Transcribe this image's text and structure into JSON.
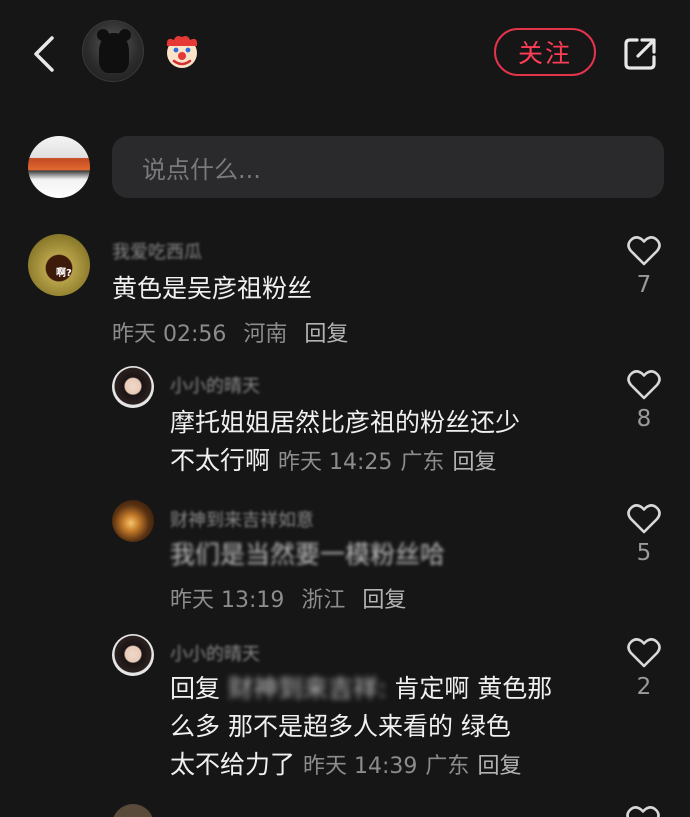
{
  "header": {
    "follow_label": "关注",
    "back_icon": "chevron-left-icon",
    "share_icon": "share-external-icon",
    "status_emoji": "🤡"
  },
  "composer": {
    "placeholder": "说点什么..."
  },
  "comments": [
    {
      "username": "我爱吃西瓜",
      "text": "黄色是吴彦祖粉丝",
      "time": "昨天 02:56",
      "location": "河南",
      "reply_label": "回复",
      "likes": "7",
      "avatar_text": "啊?",
      "replies": [
        {
          "username": "小小的晴天",
          "text_line1": "摩托姐姐居然比彦祖的粉丝还少",
          "text_line2": "不太行啊",
          "time": "昨天 14:25",
          "location": "广东",
          "reply_label": "回复",
          "likes": "8"
        },
        {
          "username": "财神到来吉祥如意",
          "text_line1": "我们是当然要一模粉丝哈",
          "time": "昨天 13:19",
          "location": "浙江",
          "reply_label": "回复",
          "likes": "5"
        },
        {
          "username": "小小的晴天",
          "text_prefix": "回复",
          "text_blur": "财神到来吉祥:",
          "text_line1_rest": "肯定啊 黄色那",
          "text_line2": "么多 那不是超多人来看的 绿色",
          "text_line3": "太不给力了",
          "time": "昨天 14:39",
          "location": "广东",
          "reply_label": "回复",
          "likes": "2"
        }
      ]
    }
  ],
  "colors": {
    "background": "#161616",
    "accent": "#ff3d57",
    "input_bg": "#2a2a2c",
    "meta_text": "#8c8c8c"
  }
}
